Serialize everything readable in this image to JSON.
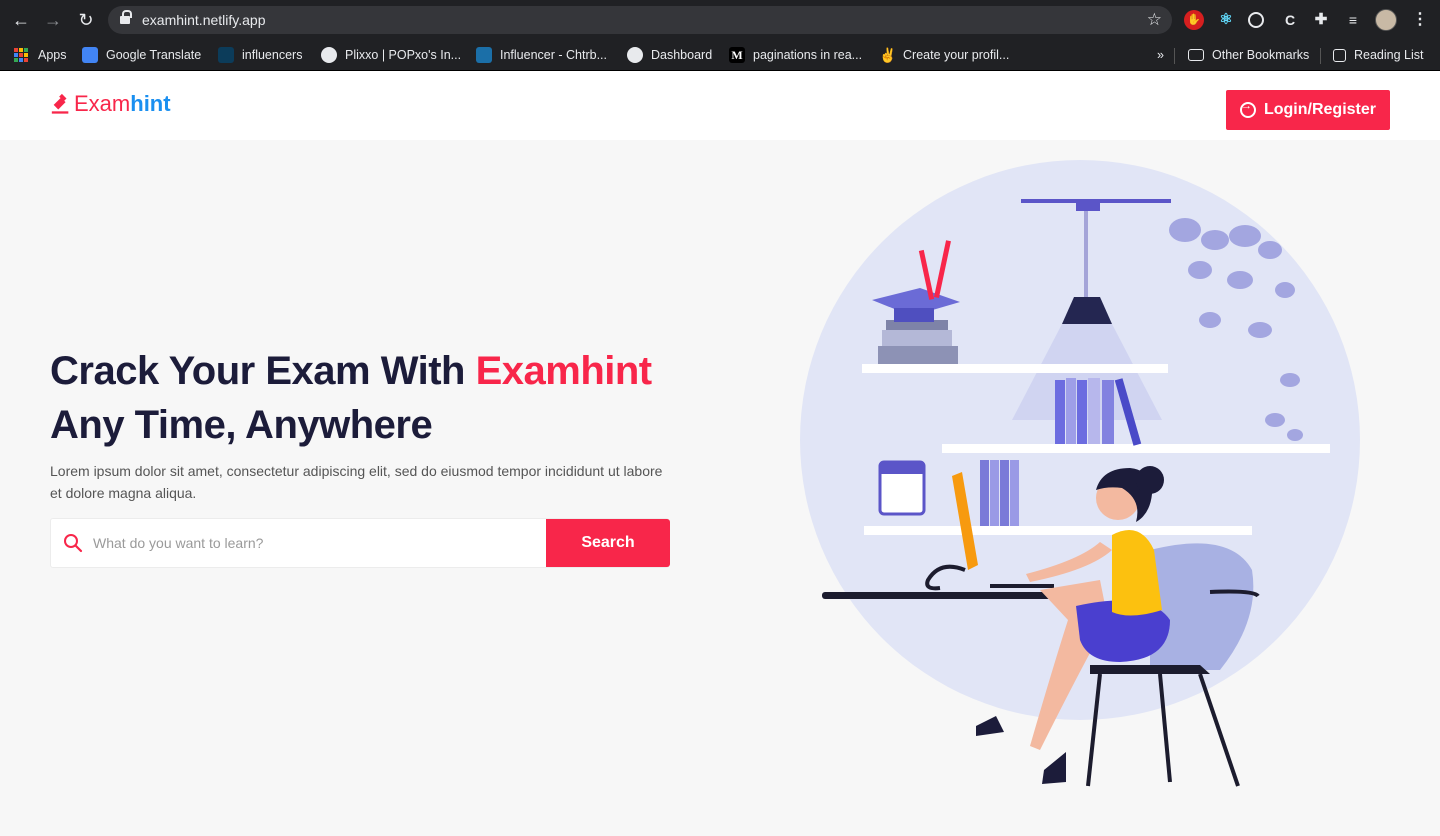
{
  "browser": {
    "url": "examhint.netlify.app",
    "bookmarks": [
      {
        "label": "Apps"
      },
      {
        "label": "Google Translate"
      },
      {
        "label": "influencers"
      },
      {
        "label": "Plixxo | POPxo's In..."
      },
      {
        "label": "Influencer - Chtrb..."
      },
      {
        "label": "Dashboard"
      },
      {
        "label": "paginations in rea..."
      },
      {
        "label": "Create your profil..."
      }
    ],
    "overflow_label": "»",
    "other_bookmarks": "Other Bookmarks",
    "reading_list": "Reading List"
  },
  "header": {
    "logo_part1": "Exam",
    "logo_part2": "hint",
    "login_label": "Login/Register"
  },
  "hero": {
    "title_part1": "Crack Your Exam With ",
    "title_accent": "Examhint",
    "title_line2": "Any Time, Anywhere",
    "description": "Lorem ipsum dolor sit amet, consectetur adipiscing elit, sed do eiusmod tempor incididunt ut labore et dolore magna aliqua."
  },
  "search": {
    "placeholder": "What do you want to learn?",
    "button_label": "Search"
  },
  "colors": {
    "brand_red": "#f8264a",
    "brand_blue": "#1a8ff0",
    "heading": "#1c1c3a"
  }
}
